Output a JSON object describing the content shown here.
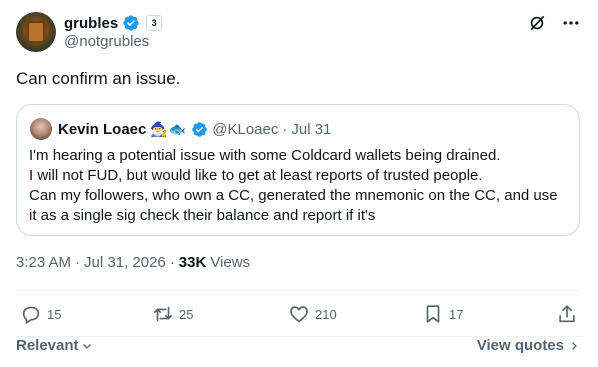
{
  "author": {
    "display_name": "grubles",
    "handle": "@notgrubles",
    "affiliate_badge": "3"
  },
  "tweet": {
    "text": "Can confirm an issue."
  },
  "quoted": {
    "display_name": "Kevin Loaec",
    "emoji": "🧙‍♂️🐟",
    "handle": "@KLoaec",
    "separator": "·",
    "date": "Jul 31",
    "lines": [
      "I'm hearing a potential issue with some Coldcard wallets being drained.",
      "I will not FUD, but would like to get at least reports of trusted people.",
      "Can my followers, who own a CC, generated the mnemonic on the CC, and use",
      "it as a single sig check their balance and report if it's"
    ]
  },
  "meta": {
    "time": "3:23 AM",
    "separator1": "·",
    "date": "Jul 31, 2026",
    "separator2": "·",
    "views_count": "33K",
    "views_label": "Views"
  },
  "actions": {
    "replies": "15",
    "reposts": "25",
    "likes": "210",
    "bookmarks": "17"
  },
  "footer": {
    "sort_label": "Relevant",
    "view_quotes_label": "View quotes"
  },
  "colors": {
    "verified": "#1d9bf0",
    "text_primary": "#0f1419",
    "text_secondary": "#536471",
    "border": "#cfd9de"
  }
}
